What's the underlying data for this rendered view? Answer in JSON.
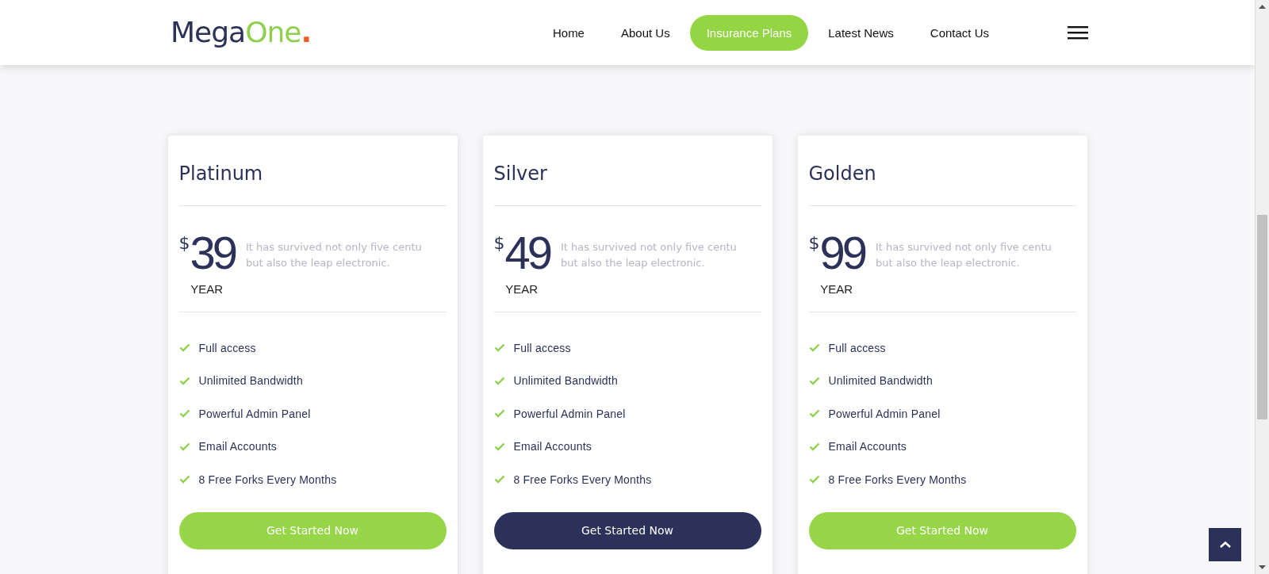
{
  "header": {
    "logo": {
      "main": "Mega",
      "accent": "One",
      "dot": "."
    },
    "nav": [
      {
        "label": "Home",
        "selected": false
      },
      {
        "label": "About Us",
        "selected": false
      },
      {
        "label": "Insurance Plans",
        "selected": true
      },
      {
        "label": "Latest News",
        "selected": false
      },
      {
        "label": "Contact Us",
        "selected": false
      }
    ]
  },
  "plans": [
    {
      "name": "Platinum",
      "currency": "$",
      "price": "39",
      "period": "YEAR",
      "description": "It has survived not only five centu but also the leap electronic.",
      "features": [
        "Full access",
        "Unlimited Bandwidth",
        "Powerful Admin Panel",
        "Email Accounts",
        "8 Free Forks Every Months"
      ],
      "button": "Get Started Now",
      "highlighted": false
    },
    {
      "name": "Silver",
      "currency": "$",
      "price": "49",
      "period": "YEAR",
      "description": "It has survived not only five centu but also the leap electronic.",
      "features": [
        "Full access",
        "Unlimited Bandwidth",
        "Powerful Admin Panel",
        "Email Accounts",
        "8 Free Forks Every Months"
      ],
      "button": "Get Started Now",
      "highlighted": true
    },
    {
      "name": "Golden",
      "currency": "$",
      "price": "99",
      "period": "YEAR",
      "description": "It has survived not only five centu but also the leap electronic.",
      "features": [
        "Full access",
        "Unlimited Bandwidth",
        "Powerful Admin Panel",
        "Email Accounts",
        "8 Free Forks Every Months"
      ],
      "button": "Get Started Now",
      "highlighted": false
    }
  ]
}
